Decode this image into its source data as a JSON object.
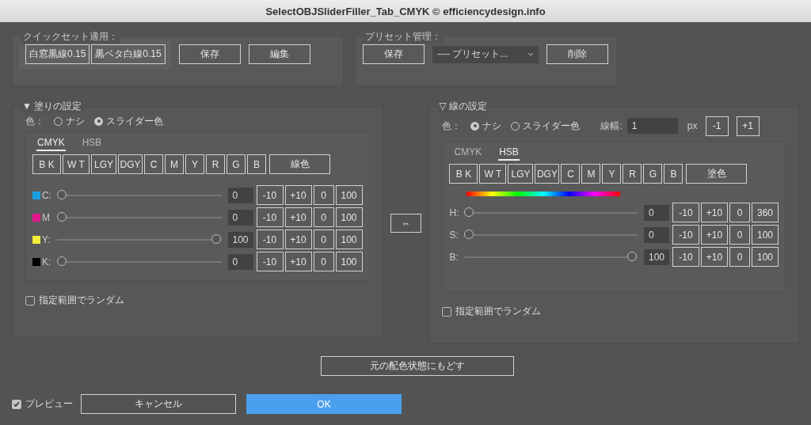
{
  "window": {
    "title": "SelectOBJSliderFiller_Tab_CMYK © efficiencydesign.info"
  },
  "quick_set": {
    "label": "クイックセット適用：",
    "presets": [
      "白窓黒線0.15",
      "黒ベタ白線0.15"
    ],
    "buttons": [
      "保存",
      "編集"
    ]
  },
  "preset_manage": {
    "label": "プリセット管理：",
    "save": "保存",
    "dropdown": "---- プリセット...",
    "delete": "削除"
  },
  "panels": [
    {
      "header": "▼ 塗りの設定",
      "color_label": "色：",
      "radios": [
        {
          "label": "ナシ",
          "selected": false
        },
        {
          "label": "スライダー色",
          "selected": true
        }
      ],
      "tabs": [
        {
          "label": "CMYK",
          "selected": true
        },
        {
          "label": "HSB",
          "selected": false
        }
      ],
      "swatches": [
        "B K",
        "W T",
        "LGY",
        "DGY",
        "C",
        "M",
        "Y",
        "R",
        "G",
        "B"
      ],
      "copy_button": "線色",
      "sliders": [
        {
          "label": "C:",
          "color": "#1ba1e2",
          "level": 0,
          "value": "0",
          "buttons": [
            "-10",
            "+10",
            "0",
            "100"
          ]
        },
        {
          "label": "M",
          "color": "#e3168c",
          "level": 0,
          "value": "0",
          "buttons": [
            "-10",
            "+10",
            "0",
            "100"
          ]
        },
        {
          "label": "Y:",
          "color": "#f5ec3a",
          "level": 1,
          "value": "100",
          "buttons": [
            "-10",
            "+10",
            "0",
            "100"
          ]
        },
        {
          "label": "K:",
          "color": "#000000",
          "level": 0,
          "value": "0",
          "buttons": [
            "-10",
            "+10",
            "0",
            "100"
          ]
        }
      ],
      "random": {
        "label": "指定範囲でランダム",
        "checked": false
      }
    },
    {
      "header": "▽ 線の設定",
      "color_label": "色：",
      "radios": [
        {
          "label": "ナシ",
          "selected": true
        },
        {
          "label": "スライダー色",
          "selected": false
        }
      ],
      "width": {
        "label": "線幅:",
        "value": "1",
        "unit": "px",
        "buttons": [
          "-1",
          "+1"
        ]
      },
      "tabs": [
        {
          "label": "CMYK",
          "selected": false
        },
        {
          "label": "HSB",
          "selected": true
        }
      ],
      "swatches": [
        "B K",
        "W T",
        "LGY",
        "DGY",
        "C",
        "M",
        "Y",
        "R",
        "G",
        "B"
      ],
      "copy_button": "塗色",
      "sliders": [
        {
          "label": "H:",
          "level": 0,
          "value": "0",
          "buttons": [
            "-10",
            "+10",
            "0",
            "360"
          ]
        },
        {
          "label": "S:",
          "level": 0,
          "value": "0",
          "buttons": [
            "-10",
            "+10",
            "0",
            "100"
          ]
        },
        {
          "label": "B:",
          "level": 1,
          "value": "100",
          "buttons": [
            "-10",
            "+10",
            "0",
            "100"
          ]
        }
      ],
      "random": {
        "label": "指定範囲でランダム",
        "checked": false
      }
    }
  ],
  "swap_button": "⇔",
  "reset_button": "元の配色状態にもどす",
  "preview": {
    "label": "プレビュー",
    "checked": true
  },
  "cancel_button": "キャンセル",
  "ok_button": "OK"
}
